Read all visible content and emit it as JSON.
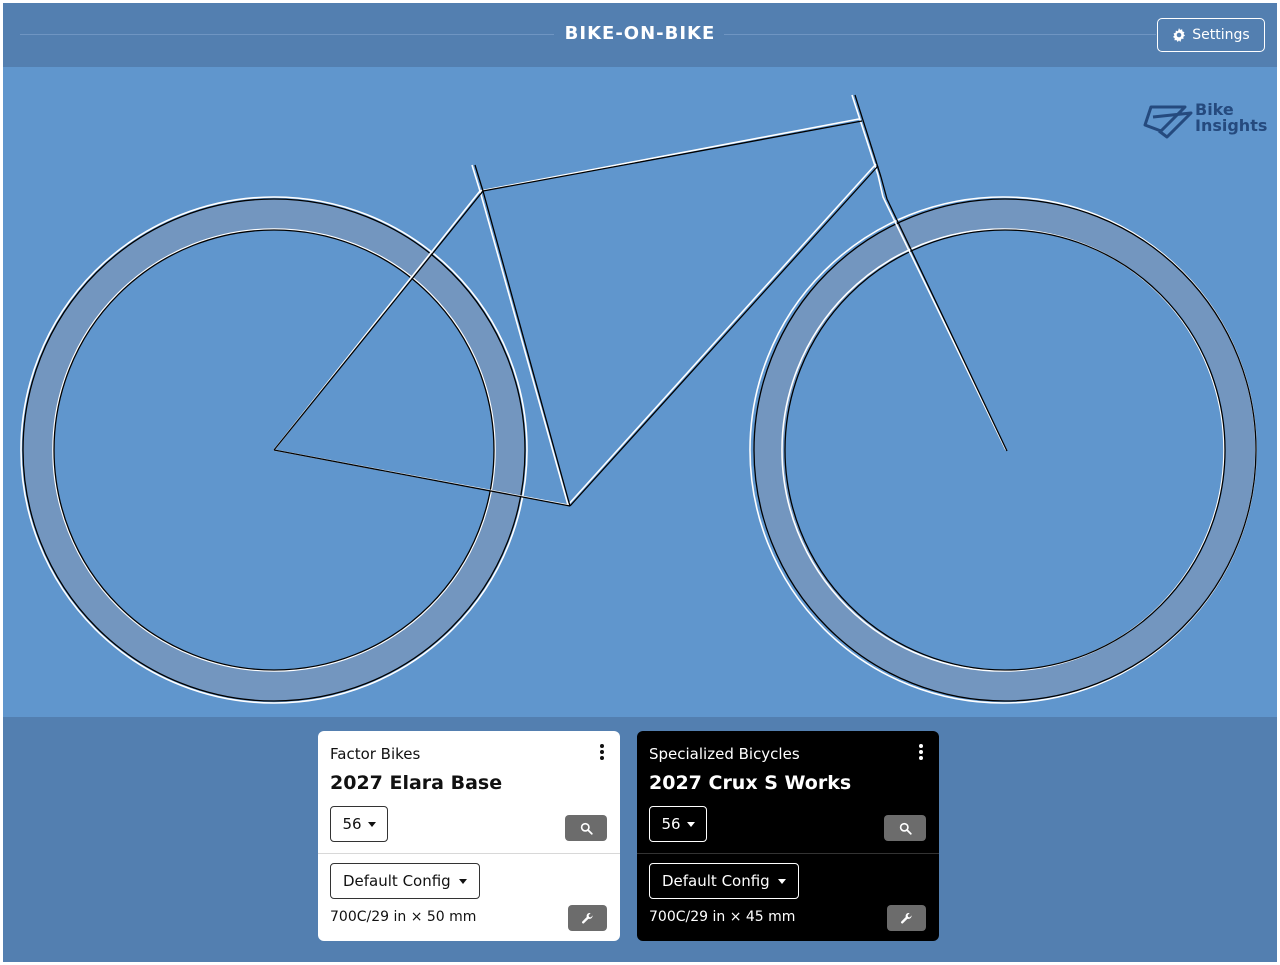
{
  "header": {
    "title": "BIKE-ON-BIKE",
    "settings_label": "Settings"
  },
  "logo": {
    "line1": "Bike",
    "line2": "Insights"
  },
  "colors": {
    "header_bg": "#537fb0",
    "canvas_bg": "#6096cd",
    "tire_fill": "#7396bf",
    "logo": "#254a7e"
  },
  "bikes": [
    {
      "brand": "Factor Bikes",
      "model": "2027 Elara Base",
      "size": "56",
      "config": "Default Config",
      "tire": "700C/29 in × 50 mm",
      "theme": "light"
    },
    {
      "brand": "Specialized Bicycles",
      "model": "2027 Crux S Works",
      "size": "56",
      "config": "Default Config",
      "tire": "700C/29 in × 45 mm",
      "theme": "dark"
    }
  ]
}
